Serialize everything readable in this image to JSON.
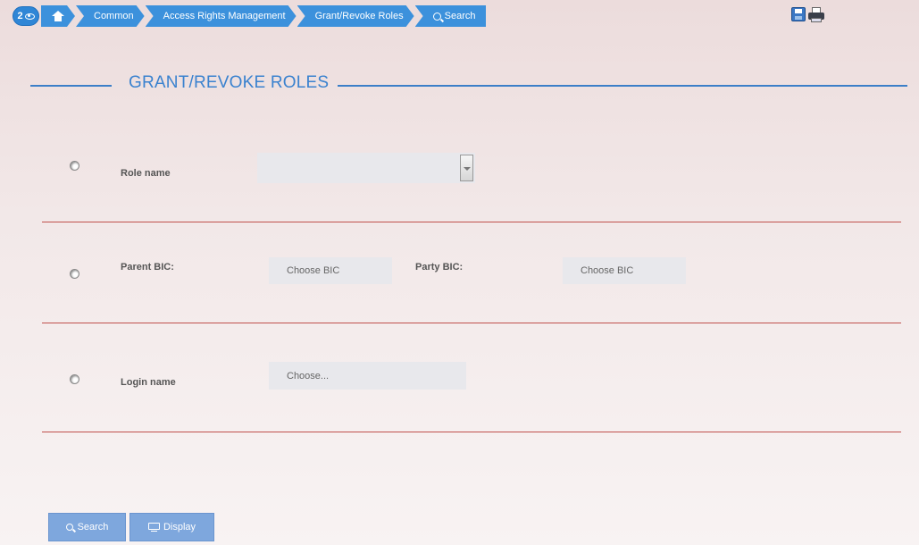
{
  "breadcrumb": {
    "badge_count": "2",
    "items": [
      {
        "label": "Common"
      },
      {
        "label": "Access Rights Management"
      },
      {
        "label": "Grant/Revoke Roles"
      },
      {
        "label": "Search"
      }
    ]
  },
  "page": {
    "title": "GRANT/REVOKE ROLES"
  },
  "form": {
    "role": {
      "label": "Role name",
      "value": ""
    },
    "parent_bic": {
      "label": "Parent BIC:",
      "placeholder": "Choose BIC"
    },
    "party_bic": {
      "label": "Party BIC:",
      "placeholder": "Choose BIC"
    },
    "login": {
      "label": "Login name",
      "placeholder": "Choose..."
    }
  },
  "buttons": {
    "search": "Search",
    "display": "Display"
  },
  "colors": {
    "accent": "#3c91dc",
    "title": "#3a82cf",
    "separator": "#c0504d",
    "button": "#7ea7dd"
  }
}
